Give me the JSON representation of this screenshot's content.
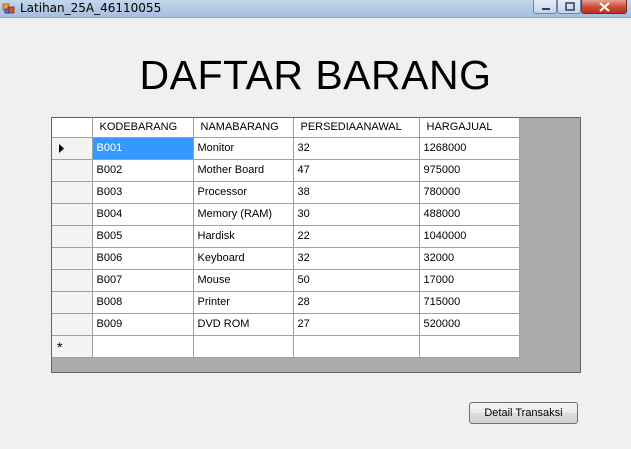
{
  "window": {
    "title": "Latihan_25A_46110055"
  },
  "heading": "DAFTAR BARANG",
  "grid": {
    "columns": [
      "KODEBARANG",
      "NAMABARANG",
      "PERSEDIAANAWAL",
      "HARGAJUAL"
    ],
    "rows": [
      [
        "B001",
        "Monitor",
        "32",
        "1268000"
      ],
      [
        "B002",
        "Mother Board",
        "47",
        "975000"
      ],
      [
        "B003",
        "Processor",
        "38",
        "780000"
      ],
      [
        "B004",
        "Memory (RAM)",
        "30",
        "488000"
      ],
      [
        "B005",
        "Hardisk",
        "22",
        "1040000"
      ],
      [
        "B006",
        "Keyboard",
        "32",
        "32000"
      ],
      [
        "B007",
        "Mouse",
        "50",
        "17000"
      ],
      [
        "B008",
        "Printer",
        "28",
        "715000"
      ],
      [
        "B009",
        "DVD ROM",
        "27",
        "520000"
      ]
    ],
    "selected_row": 0,
    "selected_column": 0,
    "new_row_marker": "*"
  },
  "detail_button_label": "Detail Transaksi",
  "colors": {
    "selection": "#3399ff",
    "grid_background": "#ababab",
    "close_button": "#c94a37"
  }
}
